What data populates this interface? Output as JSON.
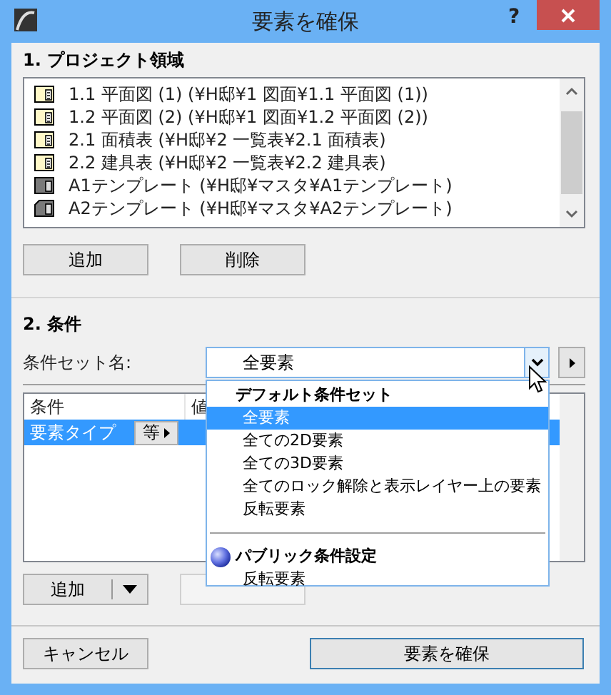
{
  "window": {
    "title": "要素を確保",
    "help": "?"
  },
  "project_area": {
    "heading": "1. プロジェクト領域",
    "items": [
      {
        "label": "1.1 平面図 (1) (¥H邸¥1 図面¥1.1 平面図 (1))",
        "kind": "layout"
      },
      {
        "label": "1.2 平面図 (2) (¥H邸¥1 図面¥1.2 平面図 (2))",
        "kind": "layout"
      },
      {
        "label": "2.1 面積表 (¥H邸¥2 一覧表¥2.1 面積表)",
        "kind": "layout"
      },
      {
        "label": "2.2 建具表 (¥H邸¥2 一覧表¥2.2 建具表)",
        "kind": "layout"
      },
      {
        "label": "A1テンプレート (¥H邸¥マスタ¥A1テンプレート)",
        "kind": "master"
      },
      {
        "label": "A2テンプレート (¥H邸¥マスタ¥A2テンプレート)",
        "kind": "master-folded"
      }
    ],
    "buttons": [
      {
        "label": "追加"
      },
      {
        "label": "削除"
      }
    ]
  },
  "criteria": {
    "heading": "2. 条件",
    "set_label": "条件セット名:",
    "set_value": "全要素",
    "table": {
      "columns": [
        "条件",
        "値"
      ],
      "rows": [
        {
          "condition": "要素タイプ",
          "operator": "等",
          "selected": true
        }
      ]
    },
    "buttons": [
      {
        "label": "追加",
        "split": true,
        "disabled": false
      },
      {
        "split": false,
        "disabled": true
      }
    ]
  },
  "dropdown": {
    "items": [
      {
        "kind": "header",
        "label": "デフォルト条件セット"
      },
      {
        "kind": "option",
        "label": "全要素",
        "selected": true
      },
      {
        "kind": "option",
        "label": "全ての2D要素",
        "selected": false
      },
      {
        "kind": "option",
        "label": "全ての3D要素",
        "selected": false
      },
      {
        "kind": "option",
        "label": "全てのロック解除と表示レイヤー上の要素",
        "selected": false
      },
      {
        "kind": "option",
        "label": "反転要素",
        "selected": false
      },
      {
        "kind": "separator"
      },
      {
        "kind": "public-header",
        "label": "パブリック条件設定"
      },
      {
        "kind": "option",
        "label": "反転要素",
        "selected": false
      }
    ]
  },
  "footer": {
    "buttons": [
      {
        "label": "キャンセル",
        "default": false
      },
      {
        "label": "要素を確保",
        "default": true
      }
    ]
  }
}
